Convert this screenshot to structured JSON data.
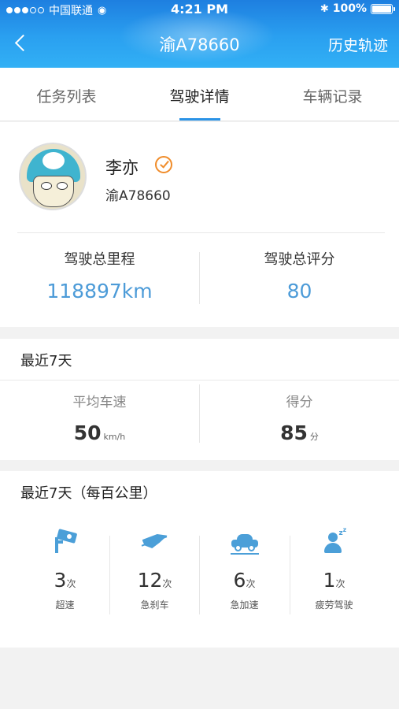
{
  "statusbar": {
    "carrier": "中国联通",
    "time": "4:21 PM",
    "battery": "100%"
  },
  "navbar": {
    "title": "渝A78660",
    "right_action": "历史轨迹"
  },
  "tabs": [
    {
      "label": "任务列表",
      "active": false
    },
    {
      "label": "驾驶详情",
      "active": true
    },
    {
      "label": "车辆记录",
      "active": false
    }
  ],
  "profile": {
    "name": "李亦",
    "plate": "渝A78660",
    "total_mileage_label": "驾驶总里程",
    "total_mileage_value": "118897km",
    "total_score_label": "驾驶总评分",
    "total_score_value": "80"
  },
  "recent7": {
    "title": "最近7天",
    "avg_speed_label": "平均车速",
    "avg_speed_value": "50",
    "avg_speed_unit": "km/h",
    "score_label": "得分",
    "score_value": "85",
    "score_unit": "分"
  },
  "behaviour": {
    "title": "最近7天（每百公里）",
    "items": [
      {
        "icon": "speed-camera-icon",
        "count": "3",
        "unit": "次",
        "label": "超速"
      },
      {
        "icon": "hard-brake-icon",
        "count": "12",
        "unit": "次",
        "label": "急刹车"
      },
      {
        "icon": "rapid-acceleration-car-icon",
        "count": "6",
        "unit": "次",
        "label": "急加速"
      },
      {
        "icon": "fatigue-driving-icon",
        "count": "1",
        "unit": "次",
        "label": "疲劳驾驶"
      }
    ]
  },
  "colors": {
    "header_blue": "#1e7fe0",
    "accent_blue": "#4c9bd8",
    "tab_indicator": "#2b93e6",
    "verified_orange": "#f08c2a"
  }
}
